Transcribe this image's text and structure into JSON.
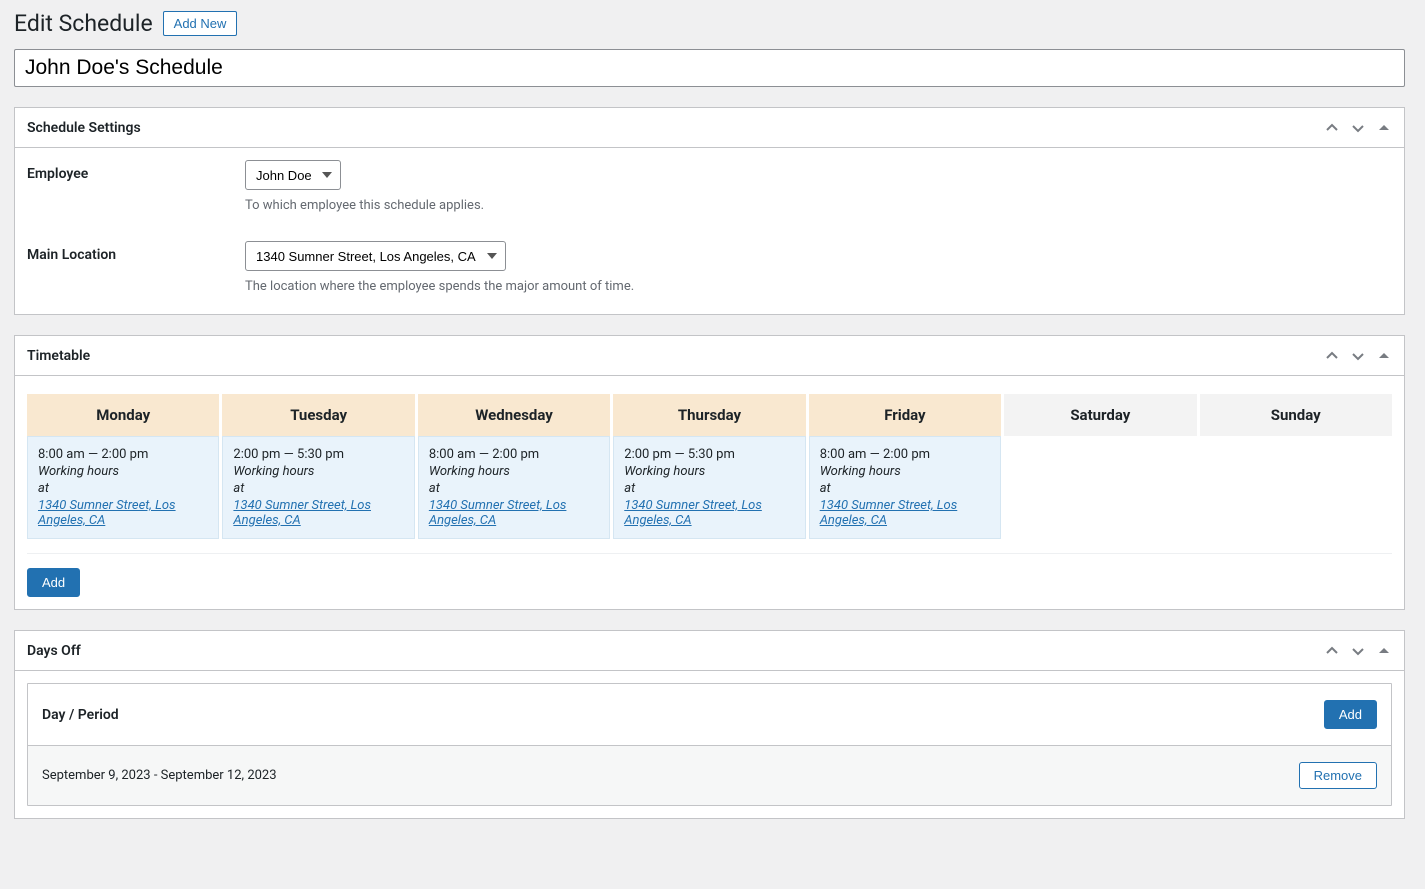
{
  "header": {
    "title": "Edit Schedule",
    "add_new": "Add New"
  },
  "schedule_title": "John Doe's Schedule",
  "panels": {
    "settings": {
      "heading": "Schedule Settings",
      "employee": {
        "label": "Employee",
        "value": "John Doe",
        "hint": "To which employee this schedule applies."
      },
      "location": {
        "label": "Main Location",
        "value": "1340 Sumner Street, Los Angeles, CA",
        "hint": "The location where the employee spends the major amount of time."
      }
    },
    "timetable": {
      "heading": "Timetable",
      "add_button": "Add",
      "days": [
        {
          "name": "Monday",
          "workday": true,
          "time": "8:00 am — 2:00 pm",
          "activity": "Working hours",
          "at": "at",
          "location": "1340 Sumner Street, Los Angeles, CA"
        },
        {
          "name": "Tuesday",
          "workday": true,
          "time": "2:00 pm — 5:30 pm",
          "activity": "Working hours",
          "at": "at",
          "location": "1340 Sumner Street, Los Angeles, CA"
        },
        {
          "name": "Wednesday",
          "workday": true,
          "time": "8:00 am — 2:00 pm",
          "activity": "Working hours",
          "at": "at",
          "location": "1340 Sumner Street, Los Angeles, CA"
        },
        {
          "name": "Thursday",
          "workday": true,
          "time": "2:00 pm — 5:30 pm",
          "activity": "Working hours",
          "at": "at",
          "location": "1340 Sumner Street, Los Angeles, CA"
        },
        {
          "name": "Friday",
          "workday": true,
          "time": "8:00 am — 2:00 pm",
          "activity": "Working hours",
          "at": "at",
          "location": "1340 Sumner Street, Los Angeles, CA"
        },
        {
          "name": "Saturday",
          "workday": false
        },
        {
          "name": "Sunday",
          "workday": false
        }
      ]
    },
    "daysoff": {
      "heading": "Days Off",
      "header_label": "Day / Period",
      "add_button": "Add",
      "rows": [
        {
          "period": "September 9, 2023 - September 12, 2023",
          "remove": "Remove"
        }
      ]
    }
  }
}
